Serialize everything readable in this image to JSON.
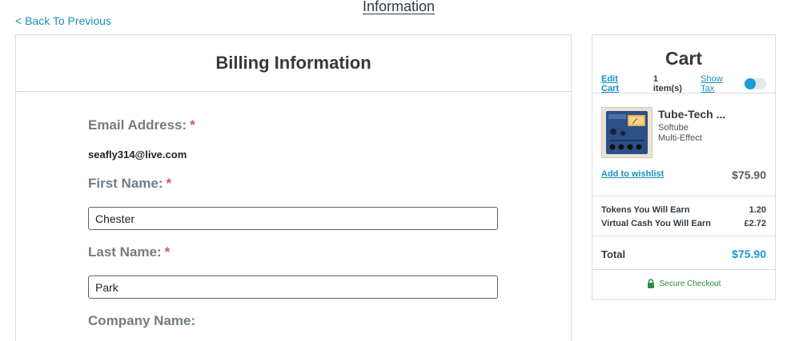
{
  "page": {
    "top_title": "Information",
    "back_link": "< Back To Previous"
  },
  "billing": {
    "title": "Billing Information",
    "email": {
      "label": "Email Address:",
      "required_mark": "*",
      "value": "seafly314@live.com"
    },
    "first_name": {
      "label": "First Name:",
      "required_mark": "*",
      "value": "Chester"
    },
    "last_name": {
      "label": "Last Name:",
      "required_mark": "*",
      "value": "Park"
    },
    "company_name": {
      "label": "Company Name:"
    }
  },
  "cart": {
    "title": "Cart",
    "edit_cart": "Edit Cart",
    "item_count": "1 item(s)",
    "show_tax": "Show Tax",
    "show_tax_on": false,
    "item": {
      "name": "Tube-Tech ...",
      "brand": "Softube",
      "category": "Multi-Effect",
      "thumbnail_icon": "product-thumbnail",
      "add_to_wishlist": "Add to wishlist",
      "price": "$75.90"
    },
    "earn": [
      {
        "label": "Tokens You Will Earn",
        "value": "1.20"
      },
      {
        "label": "Virtual Cash You Will Earn",
        "value": "£2.72"
      }
    ],
    "total_label": "Total",
    "total_value": "$75.90",
    "secure_checkout": "Secure Checkout",
    "secure_icon": "lock-icon"
  },
  "colors": {
    "accent": "#1a9ad6",
    "link": "#1a8fbf",
    "required": "#d9534f",
    "secure": "#2e8b3d",
    "label_gray": "#737c84"
  }
}
